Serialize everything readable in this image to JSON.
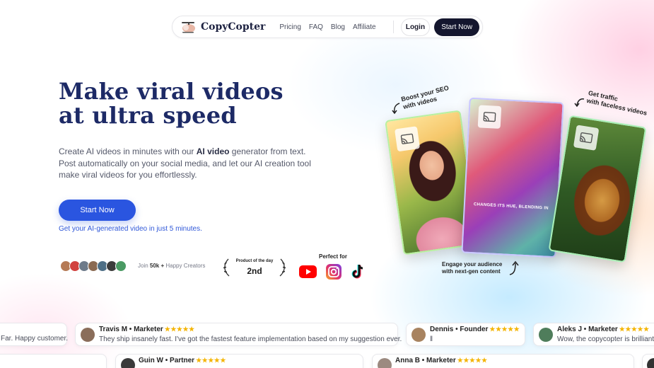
{
  "brand": {
    "name": "CopyCopter"
  },
  "nav": {
    "links": [
      "Pricing",
      "FAQ",
      "Blog",
      "Affiliate"
    ],
    "login": "Login",
    "start": "Start Now"
  },
  "hero": {
    "title_line1": "Make viral videos",
    "title_line2": "at ultra speed",
    "desc_part1": "Create AI videos in minutes with our ",
    "desc_bold": "AI video",
    "desc_part2": " generator from text. Post automatically on your social media, and let our AI creation tool make viral videos for you effortlessly.",
    "cta": "Start Now",
    "note": "Get your AI-generated video in just 5 minutes."
  },
  "proof": {
    "join_prefix": "Join ",
    "join_count": "50k +",
    "join_suffix": " Happy Creators",
    "badge_label": "Product of the day",
    "badge_rank": "2nd",
    "perfect_for": "Perfect for",
    "platforms": [
      "youtube-icon",
      "instagram-icon",
      "tiktok-icon"
    ]
  },
  "cards": {
    "annot_seo": "Boost your SEO\nwith videos",
    "annot_traffic": "Get traffic\nwith faceless videos",
    "annot_engage": "Engage your audience\nwith next-gen content",
    "caption": "CHANGES ITS HUE, BLENDING IN"
  },
  "testimonials": [
    {
      "name": "",
      "stars": "",
      "text": "Far. Happy customer."
    },
    {
      "name": "Travis M • Marketer",
      "stars": "★★★★★",
      "text": "They ship insanely fast. I've got the fastest feature implementation based on my suggestion ever."
    },
    {
      "name": "Dennis • Founder",
      "stars": "★★★★★",
      "text": "‖"
    },
    {
      "name": "Aleks J • Marketer",
      "stars": "★★★★★",
      "text": "Wow, the copycopter is brilliant!!"
    },
    {
      "name": "Guin W • Partner",
      "stars": "★★★★★",
      "text": ""
    },
    {
      "name": "Anna B • Marketer",
      "stars": "★★★★★",
      "text": ""
    }
  ],
  "colors": {
    "navy": "#1d2a66",
    "primary": "#2a55e0",
    "dark_button": "#14162e",
    "star": "#f4b400"
  }
}
